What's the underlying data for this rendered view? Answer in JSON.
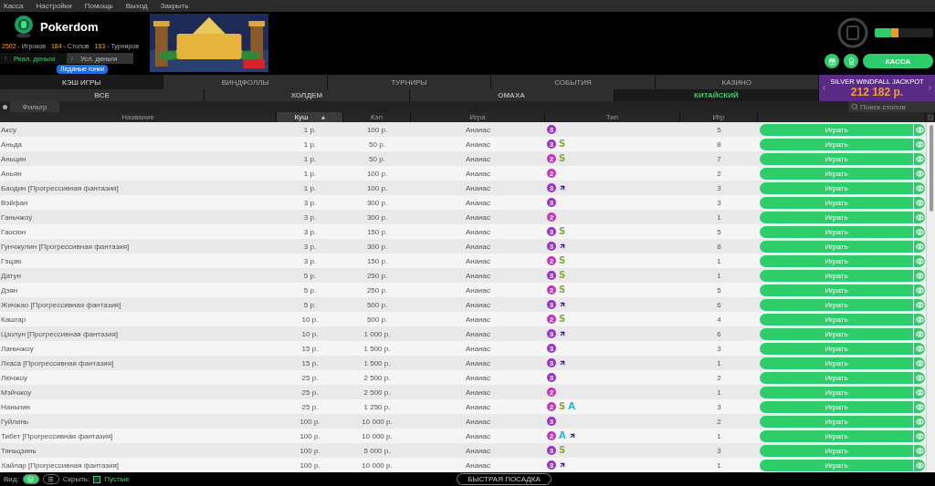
{
  "menu": [
    "Касса",
    "Настройки",
    "Помощь",
    "Выход",
    "Закрыть"
  ],
  "brand": {
    "name": "Pokerdom"
  },
  "stats": [
    {
      "count": "2502",
      "noun": " - Игроков"
    },
    {
      "count": "184",
      "noun": " - Столов"
    },
    {
      "count": "163",
      "noun": " - Турниров"
    }
  ],
  "money_tabs": [
    {
      "label": "Реал. деньги",
      "selected": true
    },
    {
      "label": "Усл. деньги",
      "selected": false
    }
  ],
  "promo_badge": "Ледяные гонки",
  "account_buttons": [
    "КАССА"
  ],
  "game_tabs": [
    {
      "label": "КЭШ ИГРЫ",
      "selected": true
    },
    {
      "label": "ВИНДФОЛЛЫ",
      "selected": false
    },
    {
      "label": "ТУРНИРЫ",
      "selected": false
    },
    {
      "label": "СОБЫТИЯ",
      "selected": false
    },
    {
      "label": "КАЗИНО",
      "selected": false
    }
  ],
  "variant_tabs": [
    {
      "label": "ВСЕ",
      "selected": false
    },
    {
      "label": "ХОЛДЕМ",
      "selected": false
    },
    {
      "label": "ОМАХА",
      "selected": false
    },
    {
      "label": "КИТАЙСКИЙ",
      "selected": true
    }
  ],
  "jackpot": {
    "title": "SILVER WINDFALL JACKPOT",
    "amount": "212 182 р."
  },
  "filter": {
    "label": "Фильтр"
  },
  "search": {
    "placeholder": "Поиск столов"
  },
  "table": {
    "columns": [
      {
        "label": "Название",
        "sorted": false
      },
      {
        "label": "Куш",
        "sorted": true
      },
      {
        "label": "Кэп",
        "sorted": false
      },
      {
        "label": "Игра",
        "sorted": false
      },
      {
        "label": "Тип",
        "sorted": false
      },
      {
        "label": "Игр",
        "sorted": false
      }
    ],
    "rows": [
      {
        "name": "Аксу",
        "stake": "1 р.",
        "cap": "100 р.",
        "game": "Ананас",
        "badge": {
          "text": "3",
          "color": "#9b2fd0"
        },
        "tags": [],
        "players": "5",
        "action": "Играть"
      },
      {
        "name": "Аньда",
        "stake": "1 р.",
        "cap": "50 р.",
        "game": "Ананас",
        "badge": {
          "text": "3",
          "color": "#9b2fd0"
        },
        "tags": [
          {
            "kind": "letter",
            "text": "S",
            "color": "#8aa63c"
          }
        ],
        "players": "8",
        "action": "Играть"
      },
      {
        "name": "Аньцин",
        "stake": "1 р.",
        "cap": "50 р.",
        "game": "Ананас",
        "badge": {
          "text": "2",
          "color": "#c935b8"
        },
        "tags": [
          {
            "kind": "letter",
            "text": "S",
            "color": "#8aa63c"
          }
        ],
        "players": "7",
        "action": "Играть"
      },
      {
        "name": "Аньян",
        "stake": "1 р.",
        "cap": "100 р.",
        "game": "Ананас",
        "badge": {
          "text": "2",
          "color": "#c935b8"
        },
        "tags": [],
        "players": "2",
        "action": "Играть"
      },
      {
        "name": "Баодин [Прогрессивная фантазия]",
        "stake": "1 р.",
        "cap": "100 р.",
        "game": "Ананас",
        "badge": {
          "text": "3",
          "color": "#9b2fd0"
        },
        "tags": [
          {
            "kind": "arrow"
          }
        ],
        "players": "3",
        "action": "Играть"
      },
      {
        "name": "Вэйфан",
        "stake": "3 р.",
        "cap": "300 р.",
        "game": "Ананас",
        "badge": {
          "text": "3",
          "color": "#9b2fd0"
        },
        "tags": [],
        "players": "3",
        "action": "Играть"
      },
      {
        "name": "Ганьчжоу",
        "stake": "3 р.",
        "cap": "300 р.",
        "game": "Ананас",
        "badge": {
          "text": "2",
          "color": "#c935b8"
        },
        "tags": [],
        "players": "1",
        "action": "Играть"
      },
      {
        "name": "Гаосюн",
        "stake": "3 р.",
        "cap": "150 р.",
        "game": "Ананас",
        "badge": {
          "text": "3",
          "color": "#9b2fd0"
        },
        "tags": [
          {
            "kind": "letter",
            "text": "S",
            "color": "#8aa63c"
          }
        ],
        "players": "5",
        "action": "Играть"
      },
      {
        "name": "Гунчжулин [Прогрессивная фантазия]",
        "stake": "3 р.",
        "cap": "300 р.",
        "game": "Ананас",
        "badge": {
          "text": "3",
          "color": "#9b2fd0"
        },
        "tags": [
          {
            "kind": "arrow"
          }
        ],
        "players": "8",
        "action": "Играть"
      },
      {
        "name": "Гэцзю",
        "stake": "3 р.",
        "cap": "150 р.",
        "game": "Ананас",
        "badge": {
          "text": "2",
          "color": "#c935b8"
        },
        "tags": [
          {
            "kind": "letter",
            "text": "S",
            "color": "#8aa63c"
          }
        ],
        "players": "1",
        "action": "Играть"
      },
      {
        "name": "Датун",
        "stake": "5 р.",
        "cap": "250 р.",
        "game": "Ананас",
        "badge": {
          "text": "3",
          "color": "#9b2fd0"
        },
        "tags": [
          {
            "kind": "letter",
            "text": "S",
            "color": "#8aa63c"
          }
        ],
        "players": "1",
        "action": "Играть"
      },
      {
        "name": "Дэян",
        "stake": "5 р.",
        "cap": "250 р.",
        "game": "Ананас",
        "badge": {
          "text": "2",
          "color": "#c935b8"
        },
        "tags": [
          {
            "kind": "letter",
            "text": "S",
            "color": "#8aa63c"
          }
        ],
        "players": "5",
        "action": "Играть"
      },
      {
        "name": "Жичжао [Прогрессивная фантазия]",
        "stake": "5 р.",
        "cap": "500 р.",
        "game": "Ананас",
        "badge": {
          "text": "3",
          "color": "#9b2fd0"
        },
        "tags": [
          {
            "kind": "arrow"
          }
        ],
        "players": "6",
        "action": "Играть"
      },
      {
        "name": "Кашгар",
        "stake": "10 р.",
        "cap": "500 р.",
        "game": "Ананас",
        "badge": {
          "text": "2",
          "color": "#c935b8"
        },
        "tags": [
          {
            "kind": "letter",
            "text": "S",
            "color": "#8aa63c"
          }
        ],
        "players": "4",
        "action": "Играть"
      },
      {
        "name": "Цзолун [Прогрессивная фантазия]",
        "stake": "10 р.",
        "cap": "1 000 р.",
        "game": "Ананас",
        "badge": {
          "text": "3",
          "color": "#9b2fd0"
        },
        "tags": [
          {
            "kind": "arrow"
          }
        ],
        "players": "6",
        "action": "Играть"
      },
      {
        "name": "Ланьчжоу",
        "stake": "15 р.",
        "cap": "1 500 р.",
        "game": "Ананас",
        "badge": {
          "text": "3",
          "color": "#9b2fd0"
        },
        "tags": [],
        "players": "3",
        "action": "Играть"
      },
      {
        "name": "Лхаса [Прогрессивная фантазия]",
        "stake": "15 р.",
        "cap": "1 500 р.",
        "game": "Ананас",
        "badge": {
          "text": "3",
          "color": "#9b2fd0"
        },
        "tags": [
          {
            "kind": "arrow"
          }
        ],
        "players": "1",
        "action": "Играть"
      },
      {
        "name": "Лючжоу",
        "stake": "25 р.",
        "cap": "2 500 р.",
        "game": "Ананас",
        "badge": {
          "text": "3",
          "color": "#9b2fd0"
        },
        "tags": [],
        "players": "2",
        "action": "Играть"
      },
      {
        "name": "Мэйчжоу",
        "stake": "25 р.",
        "cap": "2 500 р.",
        "game": "Ананас",
        "badge": {
          "text": "2",
          "color": "#c935b8"
        },
        "tags": [],
        "players": "1",
        "action": "Играть"
      },
      {
        "name": "Наньпин",
        "stake": "25 р.",
        "cap": "1 250 р.",
        "game": "Ананас",
        "badge": {
          "text": "2",
          "color": "#c935b8"
        },
        "tags": [
          {
            "kind": "letter",
            "text": "S",
            "color": "#8aa63c"
          },
          {
            "kind": "letter",
            "text": "A",
            "color": "#25b4d8"
          }
        ],
        "players": "3",
        "action": "Играть"
      },
      {
        "name": "Гуйлинь",
        "stake": "100 р.",
        "cap": "10 000 р.",
        "game": "Ананас",
        "badge": {
          "text": "3",
          "color": "#9b2fd0"
        },
        "tags": [],
        "players": "2",
        "action": "Играть"
      },
      {
        "name": "Тибет [Прогрессивная фантазия]",
        "stake": "100 р.",
        "cap": "10 000 р.",
        "game": "Ананас",
        "badge": {
          "text": "2",
          "color": "#c935b8"
        },
        "tags": [
          {
            "kind": "letter",
            "text": "A",
            "color": "#25b4d8"
          },
          {
            "kind": "arrow"
          }
        ],
        "players": "1",
        "action": "Играть"
      },
      {
        "name": "Тяньцзинь",
        "stake": "100 р.",
        "cap": "5 000 р.",
        "game": "Ананас",
        "badge": {
          "text": "3",
          "color": "#9b2fd0"
        },
        "tags": [
          {
            "kind": "letter",
            "text": "S",
            "color": "#8aa63c"
          }
        ],
        "players": "3",
        "action": "Играть"
      },
      {
        "name": "Хайлар [Прогрессивная фантазия]",
        "stake": "100 р.",
        "cap": "10 000 р.",
        "game": "Ананас",
        "badge": {
          "text": "3",
          "color": "#9b2fd0"
        },
        "tags": [
          {
            "kind": "arrow"
          }
        ],
        "players": "1",
        "action": "Играть"
      }
    ]
  },
  "footer": {
    "view_label": "Вид:",
    "views": [
      {
        "kind": "stack",
        "selected": true
      },
      {
        "kind": "list",
        "selected": false
      }
    ],
    "hide_label": "Скрыть:",
    "hide_empty": {
      "label": "Пустые",
      "checked": true
    },
    "quick_seat": "БЫСТРАЯ ПОСАДКА"
  }
}
